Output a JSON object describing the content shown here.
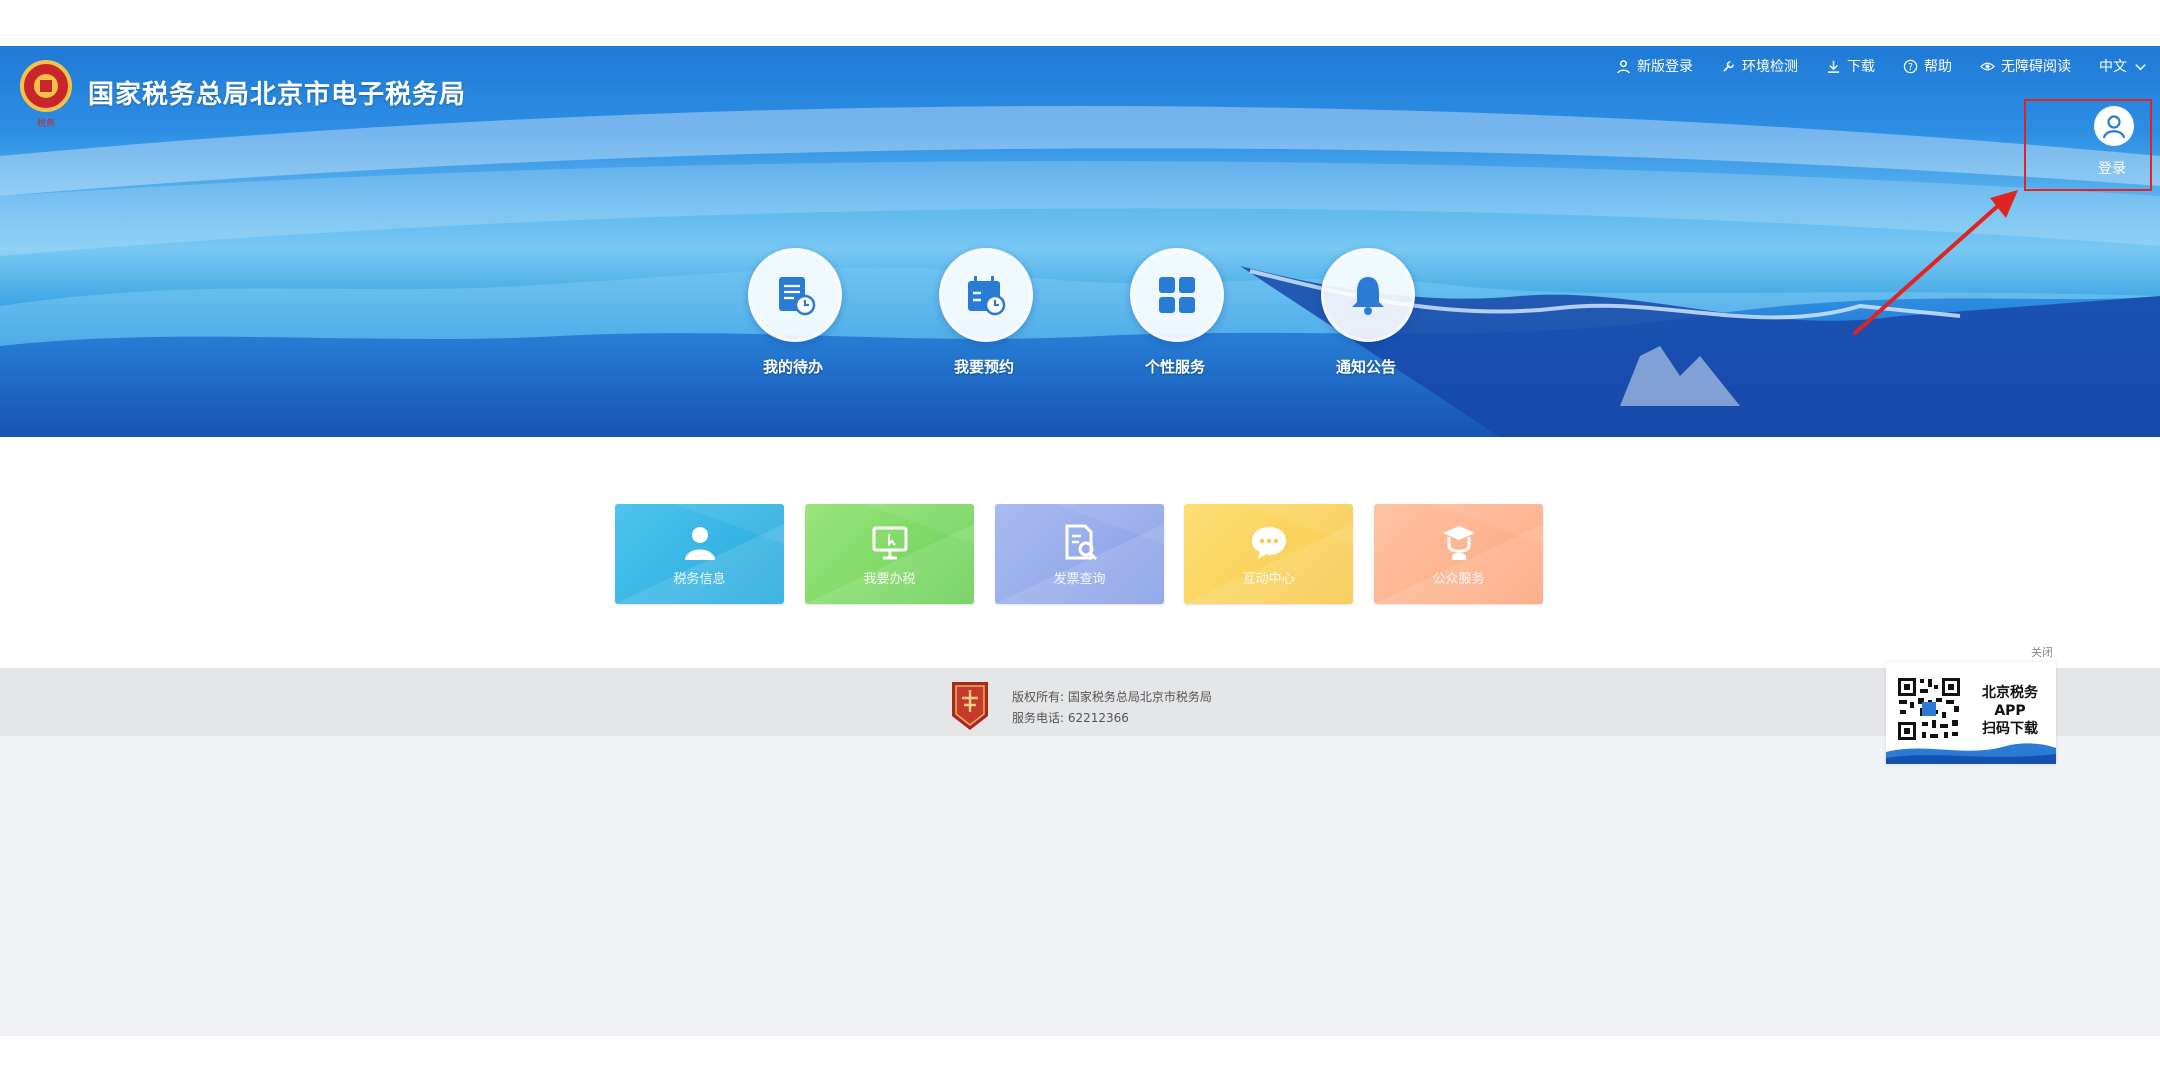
{
  "header": {
    "site_title": "国家税务总局北京市电子税务局",
    "logo_icon": "tax-emblem-icon"
  },
  "top_nav": [
    {
      "label": "新版登录",
      "icon": "user-icon"
    },
    {
      "label": "环境检测",
      "icon": "wrench-icon"
    },
    {
      "label": "下载",
      "icon": "download-icon"
    },
    {
      "label": "帮助",
      "icon": "help-icon"
    },
    {
      "label": "无障碍阅读",
      "icon": "eye-icon"
    },
    {
      "label": "中文",
      "icon": "chevron-down-icon"
    }
  ],
  "login": {
    "label": "登录",
    "highlight_color": "#e02424"
  },
  "quick_entries": [
    {
      "label": "我的待办",
      "icon": "todo-icon"
    },
    {
      "label": "我要预约",
      "icon": "calendar-icon"
    },
    {
      "label": "个性服务",
      "icon": "grid-icon"
    },
    {
      "label": "通知公告",
      "icon": "bell-icon"
    }
  ],
  "tiles": [
    {
      "label": "税务信息",
      "icon": "person-icon",
      "color": "#32b2e4"
    },
    {
      "label": "我要办税",
      "icon": "monitor-icon",
      "color": "#7ad966"
    },
    {
      "label": "发票查询",
      "icon": "document-search-icon",
      "color": "#92a8ea"
    },
    {
      "label": "互动中心",
      "icon": "chat-icon",
      "color": "#fad35c"
    },
    {
      "label": "公众服务",
      "icon": "service-icon",
      "color": "#fdb18d"
    }
  ],
  "footer": {
    "copyright": "版权所有: 国家税务总局北京市税务局",
    "phone": "服务电话: 62212366",
    "logo_icon": "tax-seal-icon"
  },
  "app_download": {
    "close_label": "关闭",
    "line1": "北京税务",
    "line2": "APP",
    "line3": "扫码下载",
    "qr_icon": "qr-code-icon"
  }
}
